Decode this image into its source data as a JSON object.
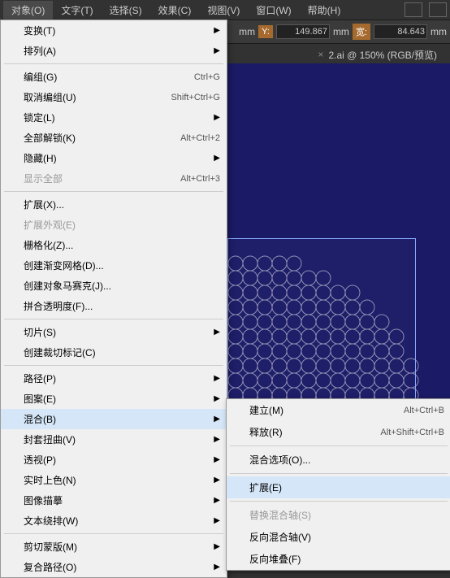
{
  "menubar": {
    "items": [
      "对象(O)",
      "文字(T)",
      "选择(S)",
      "效果(C)",
      "视图(V)",
      "窗口(W)",
      "帮助(H)"
    ]
  },
  "toolbar": {
    "unit": "mm",
    "y_label": "Y:",
    "y_value": "149.867",
    "w_label": "宽:",
    "w_value": "84.643",
    "suffix": "mm"
  },
  "tab": {
    "close": "×",
    "title": "2.ai @ 150% (RGB/预览)"
  },
  "menu": {
    "groups": [
      [
        {
          "label": "变换(T)",
          "sub": true
        },
        {
          "label": "排列(A)",
          "sub": true
        }
      ],
      [
        {
          "label": "编组(G)",
          "shortcut": "Ctrl+G"
        },
        {
          "label": "取消编组(U)",
          "shortcut": "Shift+Ctrl+G"
        },
        {
          "label": "锁定(L)",
          "sub": true
        },
        {
          "label": "全部解锁(K)",
          "shortcut": "Alt+Ctrl+2"
        },
        {
          "label": "隐藏(H)",
          "sub": true
        },
        {
          "label": "显示全部",
          "shortcut": "Alt+Ctrl+3",
          "dis": true
        }
      ],
      [
        {
          "label": "扩展(X)..."
        },
        {
          "label": "扩展外观(E)",
          "dis": true
        },
        {
          "label": "栅格化(Z)..."
        },
        {
          "label": "创建渐变网格(D)..."
        },
        {
          "label": "创建对象马赛克(J)..."
        },
        {
          "label": "拼合透明度(F)..."
        }
      ],
      [
        {
          "label": "切片(S)",
          "sub": true
        },
        {
          "label": "创建裁切标记(C)"
        }
      ],
      [
        {
          "label": "路径(P)",
          "sub": true
        },
        {
          "label": "图案(E)",
          "sub": true
        },
        {
          "label": "混合(B)",
          "sub": true,
          "hl": true
        },
        {
          "label": "封套扭曲(V)",
          "sub": true
        },
        {
          "label": "透视(P)",
          "sub": true
        },
        {
          "label": "实时上色(N)",
          "sub": true
        },
        {
          "label": "图像描摹",
          "sub": true
        },
        {
          "label": "文本绕排(W)",
          "sub": true
        }
      ],
      [
        {
          "label": "剪切蒙版(M)",
          "sub": true
        },
        {
          "label": "复合路径(O)",
          "sub": true
        }
      ]
    ]
  },
  "submenu": {
    "groups": [
      [
        {
          "label": "建立(M)",
          "shortcut": "Alt+Ctrl+B"
        },
        {
          "label": "释放(R)",
          "shortcut": "Alt+Shift+Ctrl+B"
        }
      ],
      [
        {
          "label": "混合选项(O)..."
        }
      ],
      [
        {
          "label": "扩展(E)",
          "hl": true
        }
      ],
      [
        {
          "label": "替换混合轴(S)",
          "dis": true
        },
        {
          "label": "反向混合轴(V)"
        },
        {
          "label": "反向堆叠(F)"
        }
      ]
    ]
  }
}
